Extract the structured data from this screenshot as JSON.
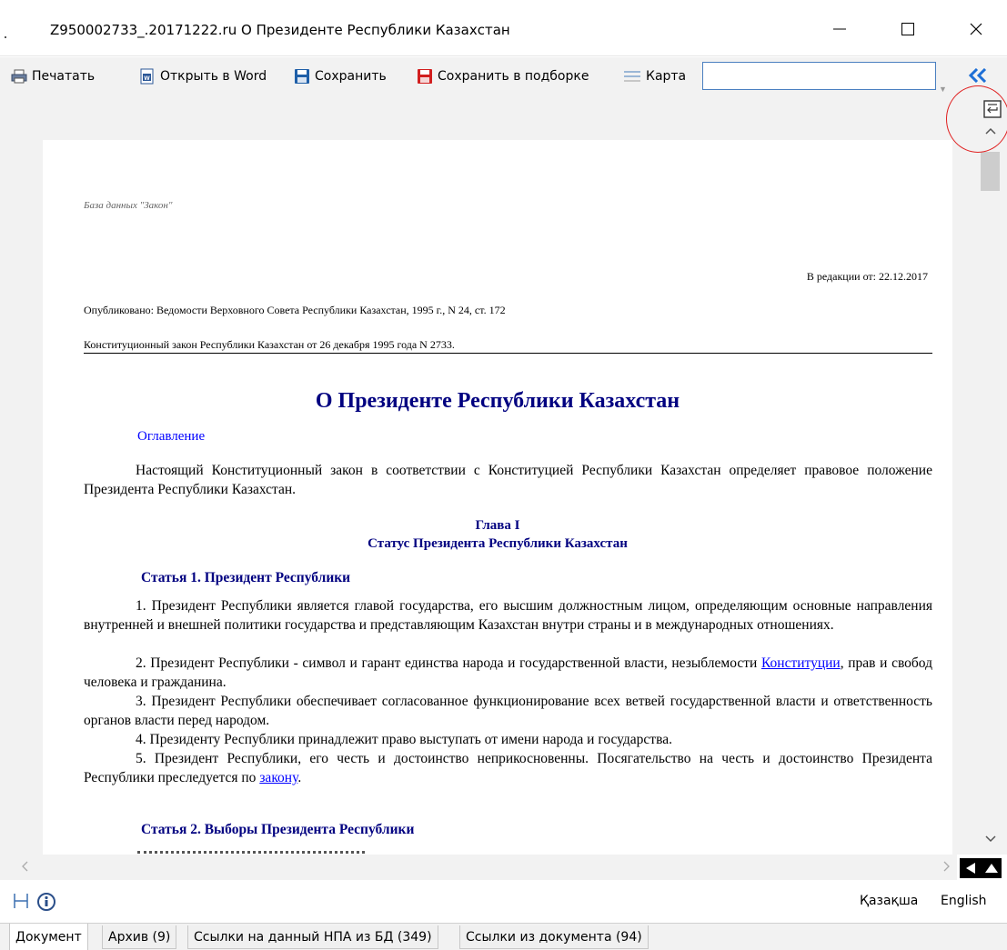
{
  "window": {
    "title": "Z950002733_.20171222.ru  О Президенте Республики Казахстан"
  },
  "toolbar": {
    "print_label": "Печатать",
    "open_word_label": "Открыть в Word",
    "save_label": "Сохранить",
    "save_collection_label": "Сохранить в подборке",
    "map_label": "Карта",
    "search_value": ""
  },
  "document": {
    "source": "База данных \"Закон\"",
    "edition": "В редакции от: 22.12.2017",
    "published": "Опубликовано: Ведомости Верховного Совета Республики Казахстан, 1995 г., N 24, ст. 172",
    "law_ref": "Конституционный закон Республики Казахстан от 26 декабря 1995 года N 2733.",
    "title": "О Президенте Республики Казахстан",
    "toc": "Оглавление",
    "intro": "Настоящий Конституционный закон в соответствии с Конституцией Республики Казахстан определяет правовое положение Президента Республики Казахстан.",
    "chapter_num": "Глава I",
    "chapter_title": "Статус Президента Республики Казахстан",
    "article1": "Статья 1. Президент Республики",
    "p1": "1. Президент Республики является главой государства, его высшим должностным лицом, определяющим основные направления внутренней и внешней политики государства и представляющим Казахстан внутри страны и в международных отношениях.",
    "p2_before": "2. Президент Республики - символ и гарант единства народа и государственной власти, незыблемости ",
    "p2_link": "Конституции",
    "p2_after": ", прав и свобод человека и гражданина.",
    "p3": "3. Президент Республики обеспечивает согласованное функционирование всех ветвей государственной власти и ответственность органов власти перед народом.",
    "p4": "4. Президенту Республики принадлежит право выступать от имени народа и государства.",
    "p5_before": "5. Президент Республики, его честь и достоинство неприкосновенны. Посягательство на честь и достоинство Президента Республики преследуется по ",
    "p5_link": "закону",
    "p5_after": ".",
    "article2": "Статья 2. Выборы Президента Республики"
  },
  "status": {
    "lang_kz": "Қазақша",
    "lang_en": "English"
  },
  "tabs": [
    {
      "label": "Документ"
    },
    {
      "label": "Архив (9)"
    },
    {
      "label": "Ссылки на данный НПА из БД (349)"
    },
    {
      "label": "Ссылки из документа (94)"
    }
  ],
  "colors": {
    "heading": "#000080",
    "link": "#0000ff",
    "accent": "#1e6fd6",
    "highlight_circle": "#e02020"
  }
}
